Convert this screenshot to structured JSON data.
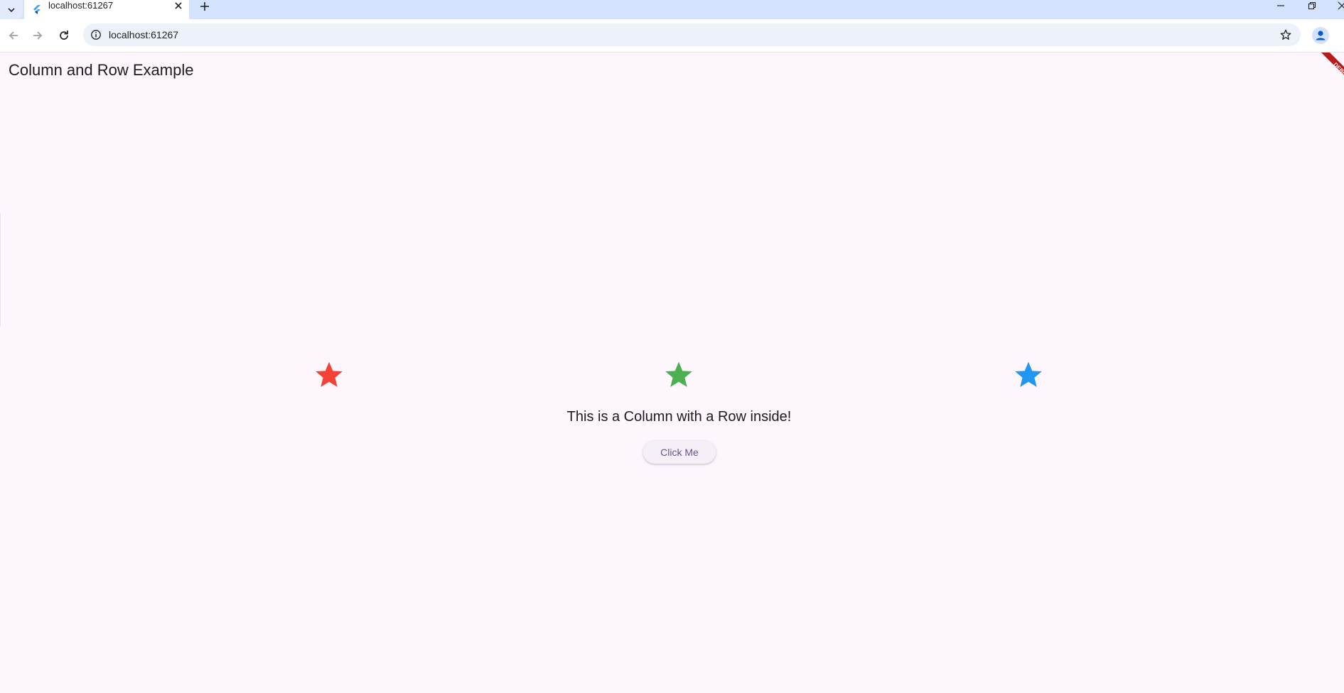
{
  "browser": {
    "tab_title": "localhost:61267",
    "url": "localhost:61267",
    "icons": {
      "tab_search": "chevron-down-icon",
      "favicon": "flutter-icon",
      "tab_close": "close-icon",
      "new_tab": "plus-icon",
      "back": "arrow-left-icon",
      "forward": "arrow-right-icon",
      "reload": "reload-icon",
      "site_info": "info-icon",
      "bookmark": "star-outline-icon",
      "profile": "person-icon",
      "minimize": "minimize-icon",
      "restore": "restore-icon",
      "close_window": "close-icon"
    }
  },
  "app": {
    "title": "Column and Row Example",
    "debug_banner": "DEBUG",
    "stars": [
      {
        "color": "#f44336",
        "icon": "star-icon"
      },
      {
        "color": "#4caf50",
        "icon": "star-icon"
      },
      {
        "color": "#2196f3",
        "icon": "star-icon"
      }
    ],
    "caption": "This is a Column with a Row inside!",
    "button_label": "Click Me",
    "colors": {
      "background": "#fdf6fd",
      "button_text": "#65558f",
      "banner": "#b71c1c"
    }
  }
}
